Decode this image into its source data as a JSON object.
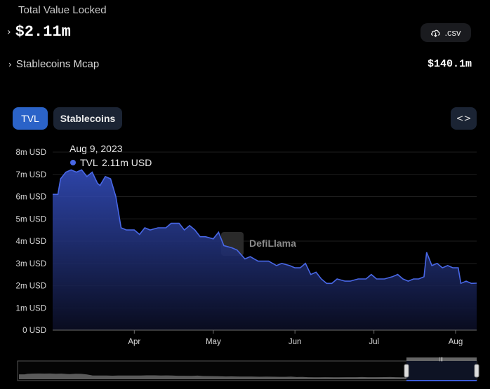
{
  "header": {
    "tvl_label": "Total Value Locked",
    "tvl_value": "$2.11m",
    "csv_label": ".csv",
    "mcap_label": "Stablecoins Mcap",
    "mcap_value": "$140.1m"
  },
  "tabs": [
    {
      "label": "TVL",
      "active": true
    },
    {
      "label": "Stablecoins",
      "active": false
    }
  ],
  "colors": {
    "accent": "#4867e6",
    "tab_active": "#2b63c8",
    "tab_inactive": "#1b2434"
  },
  "icons": {
    "csv": "cloud-download-icon",
    "embed": "code-icon",
    "expand": "chevron-right-icon"
  },
  "tooltip": {
    "date": "Aug 9, 2023",
    "series": "TVL",
    "value": "2.11m USD"
  },
  "watermark": "DefiLlama",
  "chart_data": {
    "type": "area",
    "title": "",
    "xlabel": "",
    "ylabel": "",
    "ylim": [
      0,
      8
    ],
    "xlim": [
      "2023-03-01",
      "2023-08-09"
    ],
    "grid": true,
    "y_ticks": [
      "0 USD",
      "1m USD",
      "2m USD",
      "3m USD",
      "4m USD",
      "5m USD",
      "6m USD",
      "7m USD",
      "8m USD"
    ],
    "x_ticks": [
      {
        "label": "Apr",
        "date": "2023-04-01"
      },
      {
        "label": "May",
        "date": "2023-05-01"
      },
      {
        "label": "Jun",
        "date": "2023-06-01"
      },
      {
        "label": "Jul",
        "date": "2023-07-01"
      },
      {
        "label": "Aug",
        "date": "2023-08-01"
      }
    ],
    "series": [
      {
        "name": "TVL",
        "unit": "m USD",
        "points": [
          [
            "2023-03-01",
            6.1
          ],
          [
            "2023-03-03",
            6.1
          ],
          [
            "2023-03-04",
            6.8
          ],
          [
            "2023-03-06",
            7.1
          ],
          [
            "2023-03-08",
            7.2
          ],
          [
            "2023-03-10",
            7.1
          ],
          [
            "2023-03-12",
            7.2
          ],
          [
            "2023-03-14",
            6.9
          ],
          [
            "2023-03-16",
            7.1
          ],
          [
            "2023-03-18",
            6.6
          ],
          [
            "2023-03-19",
            6.5
          ],
          [
            "2023-03-21",
            6.9
          ],
          [
            "2023-03-23",
            6.8
          ],
          [
            "2023-03-25",
            6.0
          ],
          [
            "2023-03-27",
            4.6
          ],
          [
            "2023-03-29",
            4.5
          ],
          [
            "2023-04-01",
            4.5
          ],
          [
            "2023-04-03",
            4.3
          ],
          [
            "2023-04-05",
            4.6
          ],
          [
            "2023-04-07",
            4.5
          ],
          [
            "2023-04-10",
            4.6
          ],
          [
            "2023-04-13",
            4.6
          ],
          [
            "2023-04-15",
            4.8
          ],
          [
            "2023-04-18",
            4.8
          ],
          [
            "2023-04-20",
            4.5
          ],
          [
            "2023-04-22",
            4.7
          ],
          [
            "2023-04-24",
            4.5
          ],
          [
            "2023-04-26",
            4.2
          ],
          [
            "2023-04-28",
            4.2
          ],
          [
            "2023-05-01",
            4.1
          ],
          [
            "2023-05-03",
            4.4
          ],
          [
            "2023-05-05",
            3.8
          ],
          [
            "2023-05-08",
            3.7
          ],
          [
            "2023-05-10",
            3.6
          ],
          [
            "2023-05-13",
            3.2
          ],
          [
            "2023-05-15",
            3.3
          ],
          [
            "2023-05-18",
            3.1
          ],
          [
            "2023-05-22",
            3.1
          ],
          [
            "2023-05-25",
            2.9
          ],
          [
            "2023-05-27",
            3.0
          ],
          [
            "2023-05-30",
            2.9
          ],
          [
            "2023-06-01",
            2.8
          ],
          [
            "2023-06-03",
            2.8
          ],
          [
            "2023-06-05",
            3.0
          ],
          [
            "2023-06-07",
            2.5
          ],
          [
            "2023-06-09",
            2.6
          ],
          [
            "2023-06-11",
            2.3
          ],
          [
            "2023-06-13",
            2.1
          ],
          [
            "2023-06-15",
            2.1
          ],
          [
            "2023-06-17",
            2.3
          ],
          [
            "2023-06-20",
            2.2
          ],
          [
            "2023-06-22",
            2.2
          ],
          [
            "2023-06-25",
            2.3
          ],
          [
            "2023-06-28",
            2.3
          ],
          [
            "2023-06-30",
            2.5
          ],
          [
            "2023-07-02",
            2.3
          ],
          [
            "2023-07-05",
            2.3
          ],
          [
            "2023-07-08",
            2.4
          ],
          [
            "2023-07-10",
            2.5
          ],
          [
            "2023-07-12",
            2.3
          ],
          [
            "2023-07-14",
            2.2
          ],
          [
            "2023-07-16",
            2.3
          ],
          [
            "2023-07-18",
            2.3
          ],
          [
            "2023-07-20",
            2.4
          ],
          [
            "2023-07-21",
            3.5
          ],
          [
            "2023-07-23",
            2.9
          ],
          [
            "2023-07-25",
            3.0
          ],
          [
            "2023-07-27",
            2.8
          ],
          [
            "2023-07-29",
            2.9
          ],
          [
            "2023-07-31",
            2.8
          ],
          [
            "2023-08-02",
            2.8
          ],
          [
            "2023-08-03",
            2.1
          ],
          [
            "2023-08-05",
            2.2
          ],
          [
            "2023-08-07",
            2.1
          ],
          [
            "2023-08-09",
            2.11
          ]
        ]
      }
    ]
  }
}
